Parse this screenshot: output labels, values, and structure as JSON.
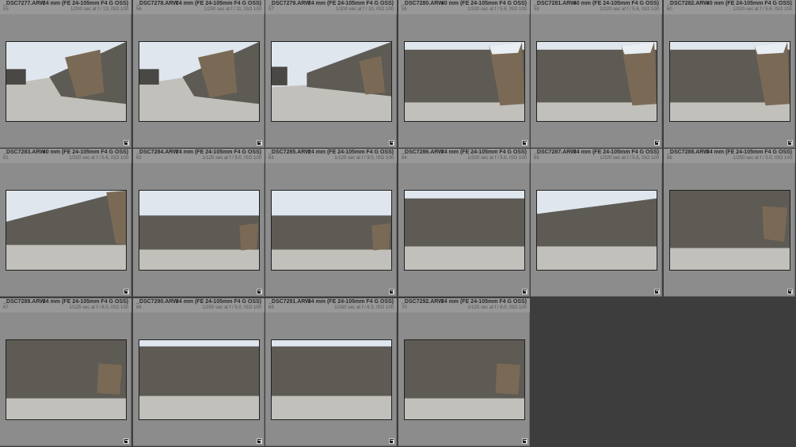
{
  "grid": {
    "photos": [
      {
        "filename": "_DSC7277.ARW",
        "lens": "24 mm (FE 24-105mm F4 G OSS)",
        "index": "55",
        "exposure": "1/200 sec at f / 13, ISO 100",
        "scene": "diag-near"
      },
      {
        "filename": "_DSC7278.ARW",
        "lens": "24 mm (FE 24-105mm F4 G OSS)",
        "index": "56",
        "exposure": "1/200 sec at f / 11, ISO 100",
        "scene": "diag-near"
      },
      {
        "filename": "_DSC7279.ARW",
        "lens": "24 mm (FE 24-105mm F4 G OSS)",
        "index": "57",
        "exposure": "1/200 sec at f / 10, ISO 100",
        "scene": "diag-mid"
      },
      {
        "filename": "_DSC7280.ARW",
        "lens": "40 mm (FE 24-105mm F4 G OSS)",
        "index": "58",
        "exposure": "1/320 sec at f / 5.6, ISO 100",
        "scene": "front-box"
      },
      {
        "filename": "_DSC7281.ARW",
        "lens": "40 mm (FE 24-105mm F4 G OSS)",
        "index": "59",
        "exposure": "1/320 sec at f / 5.6, ISO 100",
        "scene": "front-box"
      },
      {
        "filename": "_DSC7282.ARW",
        "lens": "40 mm (FE 24-105mm F4 G OSS)",
        "index": "60",
        "exposure": "1/320 sec at f / 5.6, ISO 100",
        "scene": "front-box"
      },
      {
        "filename": "_DSC7283.ARW",
        "lens": "40 mm (FE 24-105mm F4 G OSS)",
        "index": "61",
        "exposure": "1/320 sec at f / 5.6, ISO 100",
        "scene": "wall-right-edge"
      },
      {
        "filename": "_DSC7284.ARW",
        "lens": "24 mm (FE 24-105mm F4 G OSS)",
        "index": "62",
        "exposure": "1/125 sec at f / 9.0, ISO 100",
        "scene": "wide-box"
      },
      {
        "filename": "_DSC7285.ARW",
        "lens": "24 mm (FE 24-105mm F4 G OSS)",
        "index": "63",
        "exposure": "1/125 sec at f / 9.0, ISO 100",
        "scene": "wide-box"
      },
      {
        "filename": "_DSC7286.ARW",
        "lens": "34 mm (FE 24-105mm F4 G OSS)",
        "index": "64",
        "exposure": "1/320 sec at f / 5.6, ISO 100",
        "scene": "wall-only"
      },
      {
        "filename": "_DSC7287.ARW",
        "lens": "34 mm (FE 24-105mm F4 G OSS)",
        "index": "65",
        "exposure": "1/320 sec at f / 5.6, ISO 100",
        "scene": "wall-left-sky"
      },
      {
        "filename": "_DSC7288.ARW",
        "lens": "34 mm (FE 24-105mm F4 G OSS)",
        "index": "66",
        "exposure": "1/250 sec at f / 5.0, ISO 100",
        "scene": "wall-box-right"
      },
      {
        "filename": "_DSC7289.ARW",
        "lens": "34 mm (FE 24-105mm F4 G OSS)",
        "index": "67",
        "exposure": "1/125 sec at f / 8.0, ISO 100",
        "scene": "wall-box-right-high"
      },
      {
        "filename": "_DSC7290.ARW",
        "lens": "34 mm (FE 24-105mm F4 G OSS)",
        "index": "68",
        "exposure": "1/250 sec at f / 5.0, ISO 100",
        "scene": "wall-only-high"
      },
      {
        "filename": "_DSC7291.ARW",
        "lens": "34 mm (FE 24-105mm F4 G OSS)",
        "index": "69",
        "exposure": "1/160 sec at f / 6.3, ISO 100",
        "scene": "wall-only-high"
      },
      {
        "filename": "_DSC7292.ARW",
        "lens": "34 mm (FE 24-105mm F4 G OSS)",
        "index": "70",
        "exposure": "1/125 sec at f / 8.0, ISO 100",
        "scene": "wall-box-right-high"
      }
    ],
    "colors": {
      "cell_bg": "#8c8c8c",
      "header_bg": "#989898",
      "empty_bg": "#3d3d3d",
      "sky": "#dfe6ee",
      "wall": "#5e5b55",
      "ground": "#c2c0bb",
      "box": "#7a6a55"
    },
    "icons": {
      "edit_badge": "edit-badge-icon"
    }
  }
}
